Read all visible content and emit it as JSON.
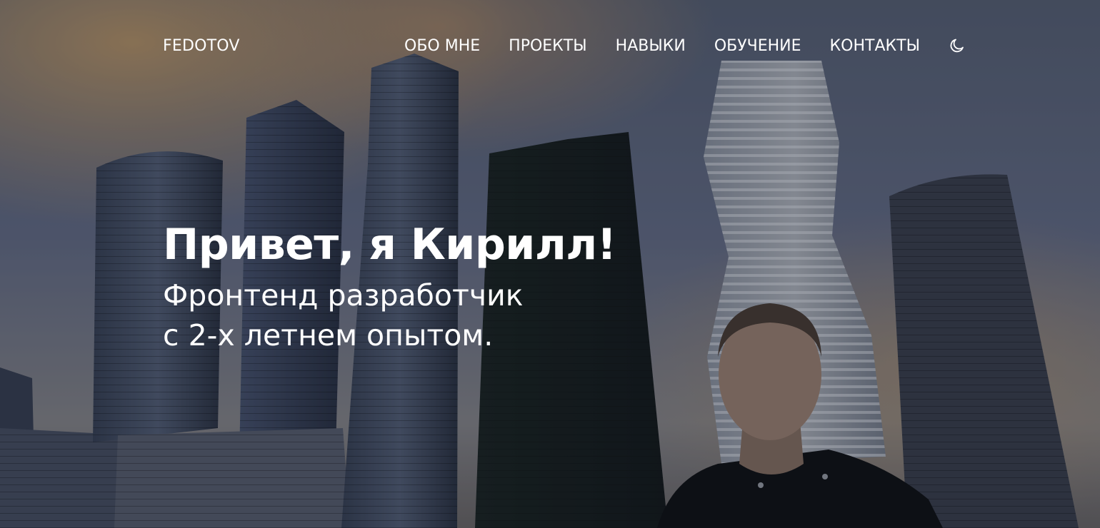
{
  "header": {
    "logo": "FEDOTOV",
    "nav": [
      {
        "label": "ОБО МНЕ"
      },
      {
        "label": "ПРОЕКТЫ"
      },
      {
        "label": "НАВЫКИ"
      },
      {
        "label": "ОБУЧЕНИЕ"
      },
      {
        "label": "КОНТАКТЫ"
      }
    ],
    "theme_toggle_icon": "moon-icon"
  },
  "hero": {
    "greeting": "Привет, я Кирилл!",
    "subtitle_line1": "Фронтенд разработчик",
    "subtitle_line2": "с 2-х летнем опытом."
  },
  "colors": {
    "text": "#ffffff",
    "sky_top": "#55627a",
    "sky_glow": "#c8a070",
    "overlay": "#080c16"
  }
}
